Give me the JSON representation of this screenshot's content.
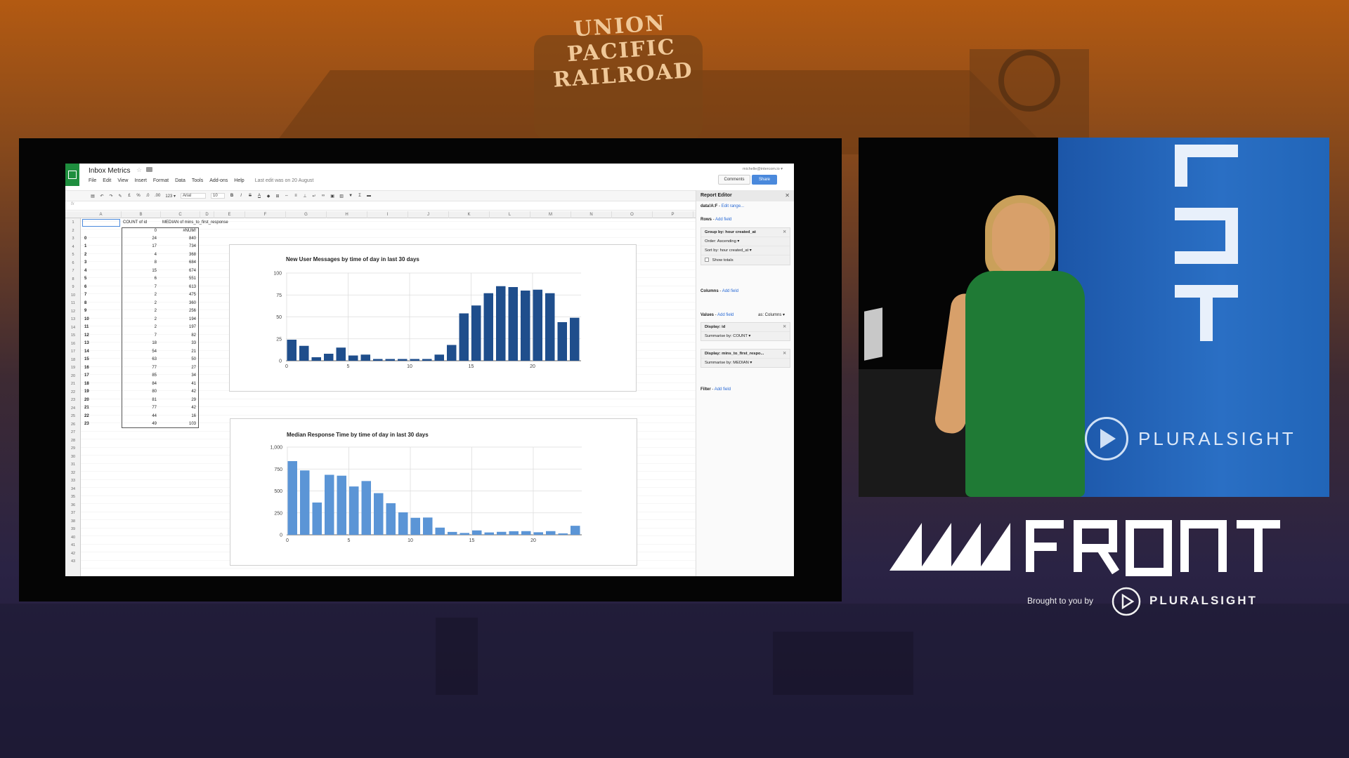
{
  "background": {
    "sign_lines": [
      "UNION",
      "PACIFIC",
      "RAILROAD"
    ],
    "colors": {
      "top": "#b35a12",
      "bottom": "#1d1938"
    }
  },
  "spreadsheet": {
    "title": "Inbox Metrics",
    "user": "michelle@intercom.io ▾",
    "comments_label": "Comments",
    "share_label": "Share",
    "menu": [
      "File",
      "Edit",
      "View",
      "Insert",
      "Format",
      "Data",
      "Tools",
      "Add-ons",
      "Help"
    ],
    "last_edit": "Last edit was on 20 August",
    "toolbar": {
      "font": "Arial",
      "size": "10",
      "items": [
        "£",
        "%",
        ".0",
        ".00",
        "123 ▾",
        "B",
        "I",
        "S",
        "A"
      ]
    },
    "fx": "fx",
    "columns": [
      "A",
      "B",
      "C",
      "D",
      "E",
      "F",
      "G",
      "H",
      "I",
      "J",
      "K",
      "L",
      "M",
      "N",
      "O",
      "P"
    ],
    "row_numbers": [
      "1",
      "2",
      "3",
      "4",
      "5",
      "6",
      "7",
      "8",
      "9",
      "10",
      "11",
      "12",
      "13",
      "14",
      "15",
      "16",
      "17",
      "18",
      "19",
      "20",
      "21",
      "22",
      "23",
      "24",
      "25",
      "26",
      "27",
      "28",
      "29",
      "30",
      "31",
      "32",
      "33",
      "34",
      "35",
      "36",
      "37",
      "38",
      "39",
      "40",
      "41",
      "42",
      "43"
    ],
    "header_b": "COUNT of id",
    "header_c": "MEDIAN of mins_to_first_response",
    "row2_b": "0",
    "row2_c": "#NUM!",
    "table_rows": [
      {
        "hour": "0",
        "count": "24",
        "median": "840"
      },
      {
        "hour": "1",
        "count": "17",
        "median": "734"
      },
      {
        "hour": "2",
        "count": "4",
        "median": "368"
      },
      {
        "hour": "3",
        "count": "8",
        "median": "684"
      },
      {
        "hour": "4",
        "count": "15",
        "median": "674"
      },
      {
        "hour": "5",
        "count": "6",
        "median": "551"
      },
      {
        "hour": "6",
        "count": "7",
        "median": "613"
      },
      {
        "hour": "7",
        "count": "2",
        "median": "475"
      },
      {
        "hour": "8",
        "count": "2",
        "median": "360"
      },
      {
        "hour": "9",
        "count": "2",
        "median": "256"
      },
      {
        "hour": "10",
        "count": "2",
        "median": "194"
      },
      {
        "hour": "11",
        "count": "2",
        "median": "197"
      },
      {
        "hour": "12",
        "count": "7",
        "median": "82"
      },
      {
        "hour": "13",
        "count": "18",
        "median": "33"
      },
      {
        "hour": "14",
        "count": "54",
        "median": "21"
      },
      {
        "hour": "15",
        "count": "63",
        "median": "50"
      },
      {
        "hour": "16",
        "count": "77",
        "median": "27"
      },
      {
        "hour": "17",
        "count": "85",
        "median": "34"
      },
      {
        "hour": "18",
        "count": "84",
        "median": "41"
      },
      {
        "hour": "19",
        "count": "80",
        "median": "42"
      },
      {
        "hour": "20",
        "count": "81",
        "median": "29"
      },
      {
        "hour": "21",
        "count": "77",
        "median": "42"
      },
      {
        "hour": "22",
        "count": "44",
        "median": "16"
      },
      {
        "hour": "23",
        "count": "49",
        "median": "103"
      }
    ]
  },
  "report_editor": {
    "title": "Report Editor",
    "range_label": "data!A:F",
    "edit_range": "Edit range...",
    "rows_label": "Rows",
    "add_field": "Add field",
    "group_by": "Group by: hour created_at",
    "order": "Order: Ascending ▾",
    "sort_by": "Sort by: hour created_at ▾",
    "show_totals": "Show totals",
    "columns_label": "Columns",
    "values_label": "Values",
    "as_columns": "as: Columns ▾",
    "display_1": "Display: id",
    "summarise_1": "Summarise by: COUNT ▾",
    "display_2": "Display: mins_to_first_respo...",
    "summarise_2": "Summarise by: MEDIAN ▾",
    "filter_label": "Filter"
  },
  "chart_data": [
    {
      "type": "bar",
      "title": "New User Messages by time of day in last 30 days",
      "x": [
        0,
        1,
        2,
        3,
        4,
        5,
        6,
        7,
        8,
        9,
        10,
        11,
        12,
        13,
        14,
        15,
        16,
        17,
        18,
        19,
        20,
        21,
        22,
        23
      ],
      "values": [
        24,
        17,
        4,
        8,
        15,
        6,
        7,
        2,
        2,
        2,
        2,
        2,
        7,
        18,
        54,
        63,
        77,
        85,
        84,
        80,
        81,
        77,
        44,
        49
      ],
      "x_ticks": [
        "0",
        "5",
        "10",
        "15",
        "20"
      ],
      "y_ticks": [
        "0",
        "25",
        "50",
        "75",
        "100"
      ],
      "ylim": [
        0,
        100
      ],
      "color": "#1f4e8c"
    },
    {
      "type": "bar",
      "title": "Median Response Time by time of day in last 30 days",
      "x": [
        0,
        1,
        2,
        3,
        4,
        5,
        6,
        7,
        8,
        9,
        10,
        11,
        12,
        13,
        14,
        15,
        16,
        17,
        18,
        19,
        20,
        21,
        22,
        23
      ],
      "values": [
        840,
        734,
        368,
        684,
        674,
        551,
        613,
        475,
        360,
        256,
        194,
        197,
        82,
        33,
        21,
        50,
        27,
        34,
        41,
        42,
        29,
        42,
        16,
        103
      ],
      "x_ticks": [
        "0",
        "5",
        "10",
        "15",
        "20"
      ],
      "y_ticks": [
        "0",
        "250",
        "500",
        "750",
        "1,000"
      ],
      "ylim": [
        0,
        1000
      ],
      "color": "#5b95d6"
    }
  ],
  "video": {
    "banner_text": "PLURALSIGHT",
    "colors": {
      "banner": "#2a6fc4",
      "dress": "#1f7a35"
    }
  },
  "branding": {
    "brought_by": "Brought to you by",
    "pluralsight": "PLURALSIGHT"
  }
}
